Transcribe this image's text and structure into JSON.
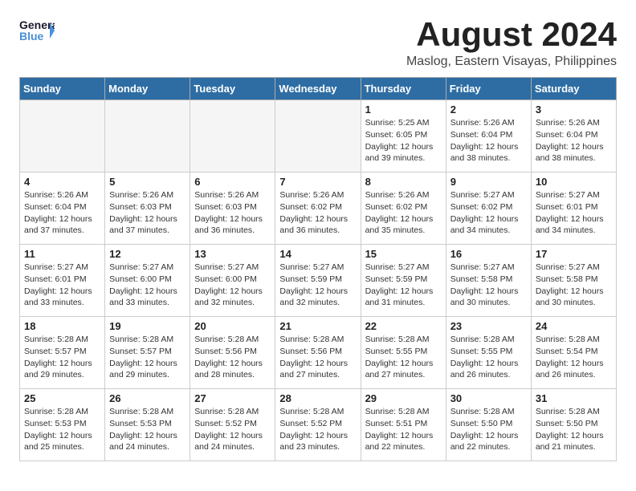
{
  "header": {
    "logo_general": "General",
    "logo_blue": "Blue",
    "month_title": "August 2024",
    "subtitle": "Maslog, Eastern Visayas, Philippines"
  },
  "days_of_week": [
    "Sunday",
    "Monday",
    "Tuesday",
    "Wednesday",
    "Thursday",
    "Friday",
    "Saturday"
  ],
  "weeks": [
    {
      "days": [
        {
          "num": "",
          "info": ""
        },
        {
          "num": "",
          "info": ""
        },
        {
          "num": "",
          "info": ""
        },
        {
          "num": "",
          "info": ""
        },
        {
          "num": "1",
          "info": "Sunrise: 5:25 AM\nSunset: 6:05 PM\nDaylight: 12 hours\nand 39 minutes."
        },
        {
          "num": "2",
          "info": "Sunrise: 5:26 AM\nSunset: 6:04 PM\nDaylight: 12 hours\nand 38 minutes."
        },
        {
          "num": "3",
          "info": "Sunrise: 5:26 AM\nSunset: 6:04 PM\nDaylight: 12 hours\nand 38 minutes."
        }
      ]
    },
    {
      "days": [
        {
          "num": "4",
          "info": "Sunrise: 5:26 AM\nSunset: 6:04 PM\nDaylight: 12 hours\nand 37 minutes."
        },
        {
          "num": "5",
          "info": "Sunrise: 5:26 AM\nSunset: 6:03 PM\nDaylight: 12 hours\nand 37 minutes."
        },
        {
          "num": "6",
          "info": "Sunrise: 5:26 AM\nSunset: 6:03 PM\nDaylight: 12 hours\nand 36 minutes."
        },
        {
          "num": "7",
          "info": "Sunrise: 5:26 AM\nSunset: 6:02 PM\nDaylight: 12 hours\nand 36 minutes."
        },
        {
          "num": "8",
          "info": "Sunrise: 5:26 AM\nSunset: 6:02 PM\nDaylight: 12 hours\nand 35 minutes."
        },
        {
          "num": "9",
          "info": "Sunrise: 5:27 AM\nSunset: 6:02 PM\nDaylight: 12 hours\nand 34 minutes."
        },
        {
          "num": "10",
          "info": "Sunrise: 5:27 AM\nSunset: 6:01 PM\nDaylight: 12 hours\nand 34 minutes."
        }
      ]
    },
    {
      "days": [
        {
          "num": "11",
          "info": "Sunrise: 5:27 AM\nSunset: 6:01 PM\nDaylight: 12 hours\nand 33 minutes."
        },
        {
          "num": "12",
          "info": "Sunrise: 5:27 AM\nSunset: 6:00 PM\nDaylight: 12 hours\nand 33 minutes."
        },
        {
          "num": "13",
          "info": "Sunrise: 5:27 AM\nSunset: 6:00 PM\nDaylight: 12 hours\nand 32 minutes."
        },
        {
          "num": "14",
          "info": "Sunrise: 5:27 AM\nSunset: 5:59 PM\nDaylight: 12 hours\nand 32 minutes."
        },
        {
          "num": "15",
          "info": "Sunrise: 5:27 AM\nSunset: 5:59 PM\nDaylight: 12 hours\nand 31 minutes."
        },
        {
          "num": "16",
          "info": "Sunrise: 5:27 AM\nSunset: 5:58 PM\nDaylight: 12 hours\nand 30 minutes."
        },
        {
          "num": "17",
          "info": "Sunrise: 5:27 AM\nSunset: 5:58 PM\nDaylight: 12 hours\nand 30 minutes."
        }
      ]
    },
    {
      "days": [
        {
          "num": "18",
          "info": "Sunrise: 5:28 AM\nSunset: 5:57 PM\nDaylight: 12 hours\nand 29 minutes."
        },
        {
          "num": "19",
          "info": "Sunrise: 5:28 AM\nSunset: 5:57 PM\nDaylight: 12 hours\nand 29 minutes."
        },
        {
          "num": "20",
          "info": "Sunrise: 5:28 AM\nSunset: 5:56 PM\nDaylight: 12 hours\nand 28 minutes."
        },
        {
          "num": "21",
          "info": "Sunrise: 5:28 AM\nSunset: 5:56 PM\nDaylight: 12 hours\nand 27 minutes."
        },
        {
          "num": "22",
          "info": "Sunrise: 5:28 AM\nSunset: 5:55 PM\nDaylight: 12 hours\nand 27 minutes."
        },
        {
          "num": "23",
          "info": "Sunrise: 5:28 AM\nSunset: 5:55 PM\nDaylight: 12 hours\nand 26 minutes."
        },
        {
          "num": "24",
          "info": "Sunrise: 5:28 AM\nSunset: 5:54 PM\nDaylight: 12 hours\nand 26 minutes."
        }
      ]
    },
    {
      "days": [
        {
          "num": "25",
          "info": "Sunrise: 5:28 AM\nSunset: 5:53 PM\nDaylight: 12 hours\nand 25 minutes."
        },
        {
          "num": "26",
          "info": "Sunrise: 5:28 AM\nSunset: 5:53 PM\nDaylight: 12 hours\nand 24 minutes."
        },
        {
          "num": "27",
          "info": "Sunrise: 5:28 AM\nSunset: 5:52 PM\nDaylight: 12 hours\nand 24 minutes."
        },
        {
          "num": "28",
          "info": "Sunrise: 5:28 AM\nSunset: 5:52 PM\nDaylight: 12 hours\nand 23 minutes."
        },
        {
          "num": "29",
          "info": "Sunrise: 5:28 AM\nSunset: 5:51 PM\nDaylight: 12 hours\nand 22 minutes."
        },
        {
          "num": "30",
          "info": "Sunrise: 5:28 AM\nSunset: 5:50 PM\nDaylight: 12 hours\nand 22 minutes."
        },
        {
          "num": "31",
          "info": "Sunrise: 5:28 AM\nSunset: 5:50 PM\nDaylight: 12 hours\nand 21 minutes."
        }
      ]
    }
  ]
}
